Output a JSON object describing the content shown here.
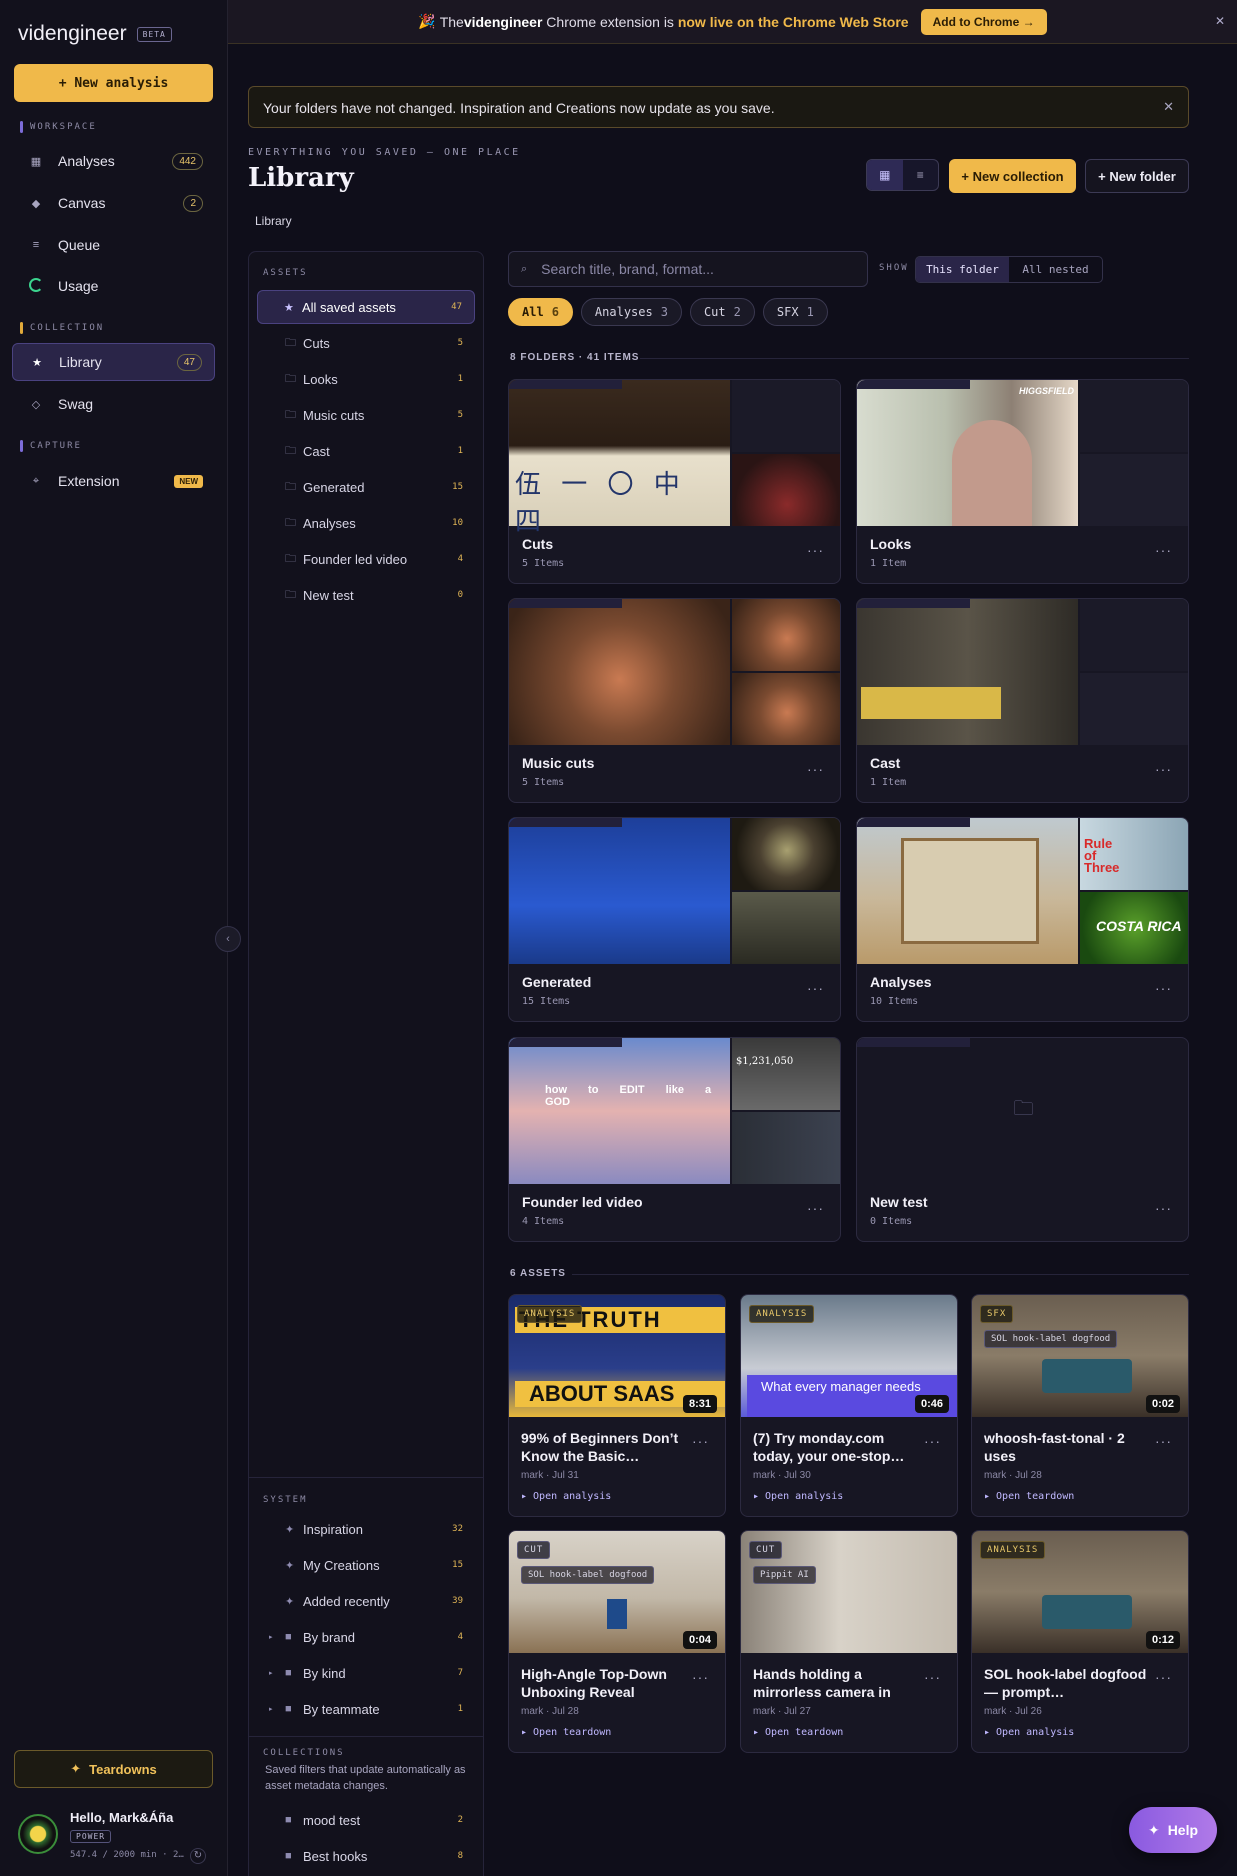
{
  "app": {
    "name": "videngineer",
    "badge": "BETA",
    "new_analysis": "+ New analysis"
  },
  "sidebar": {
    "workspace_label": "WORKSPACE",
    "collection_label": "COLLECTION",
    "capture_label": "CAPTURE",
    "items": [
      {
        "label": "Analyses",
        "badge": "442",
        "icon": "grid-icon"
      },
      {
        "label": "Canvas",
        "badge": "2",
        "icon": "diamond-icon"
      },
      {
        "label": "Queue",
        "icon": "list-icon"
      },
      {
        "label": "Usage",
        "icon": "ring-icon"
      },
      {
        "label": "Library",
        "badge": "47",
        "icon": "star-icon"
      },
      {
        "label": "Swag",
        "icon": "diamond-outline-icon"
      },
      {
        "label": "Extension",
        "badge": "NEW",
        "icon": "crosshair-icon"
      }
    ],
    "teardowns": "Teardowns",
    "profile": {
      "hello": "Hello, Mark&Áña",
      "tier": "POWER",
      "minutes": "547.4 / 2000 min · 2…"
    }
  },
  "banner": {
    "pre": "The ",
    "brand": "videngineer",
    "mid": " Chrome extension is ",
    "highlight": "now live on the Chrome Web Store",
    "button": "Add to Chrome →"
  },
  "notice": "Your folders have not changed. Inspiration and Creations now update as you save.",
  "header": {
    "eyebrow": "EVERYTHING YOU SAVED — ONE PLACE",
    "title": "Library",
    "breadcrumb": "Library",
    "new_collection": "+ New collection",
    "new_folder": "+ New folder"
  },
  "assets_panel": {
    "label": "ASSETS",
    "items": [
      {
        "label": "All saved assets",
        "count": "47"
      },
      {
        "label": "Cuts",
        "count": "5"
      },
      {
        "label": "Looks",
        "count": "1"
      },
      {
        "label": "Music cuts",
        "count": "5"
      },
      {
        "label": "Cast",
        "count": "1"
      },
      {
        "label": "Generated",
        "count": "15"
      },
      {
        "label": "Analyses",
        "count": "10"
      },
      {
        "label": "Founder led video",
        "count": "4"
      },
      {
        "label": "New test",
        "count": "0"
      }
    ],
    "system_label": "SYSTEM",
    "system": [
      {
        "label": "Inspiration",
        "count": "32"
      },
      {
        "label": "My Creations",
        "count": "15"
      },
      {
        "label": "Added recently",
        "count": "39"
      },
      {
        "label": "By brand",
        "count": "4"
      },
      {
        "label": "By kind",
        "count": "7"
      },
      {
        "label": "By teammate",
        "count": "1"
      }
    ],
    "collections_label": "COLLECTIONS",
    "collections_desc": "Saved filters that update automatically as asset metadata changes.",
    "collections": [
      {
        "label": "mood test",
        "count": "2"
      },
      {
        "label": "Best hooks",
        "count": "8"
      }
    ]
  },
  "toolbar": {
    "search_placeholder": "Search title, brand, format...",
    "show_label": "SHOW",
    "show_options": [
      "This folder",
      "All nested"
    ],
    "chips": [
      {
        "label": "All",
        "count": "6"
      },
      {
        "label": "Analyses",
        "count": "3"
      },
      {
        "label": "Cut",
        "count": "2"
      },
      {
        "label": "SFX",
        "count": "1"
      }
    ]
  },
  "folders_heading": "8 FOLDERS · 41 ITEMS",
  "folders": [
    {
      "name": "Cuts",
      "items": "5 Items"
    },
    {
      "name": "Looks",
      "items": "1 Item",
      "overlay": "HIGGSFIELD"
    },
    {
      "name": "Music cuts",
      "items": "5 Items"
    },
    {
      "name": "Cast",
      "items": "1 Item"
    },
    {
      "name": "Generated",
      "items": "15 Items"
    },
    {
      "name": "Analyses",
      "items": "10 Items"
    },
    {
      "name": "Founder led video",
      "items": "4 Items"
    },
    {
      "name": "New test",
      "items": "0 Items"
    }
  ],
  "assets_heading": "6 ASSETS",
  "assets": [
    {
      "tag": "ANALYSIS",
      "duration": "8:31",
      "title": "99% of Beginners Don’t Know the Basic…",
      "meta": "mark · Jul 31",
      "action": "▸ Open analysis"
    },
    {
      "tag": "ANALYSIS",
      "duration": "0:46",
      "title": "(7) Try monday.com today, your one-stop…",
      "meta": "mark · Jul 30",
      "action": "▸ Open analysis"
    },
    {
      "tag": "SFX",
      "sublabel": "SOL hook-label dogfood",
      "duration": "0:02",
      "title": "whoosh-fast-tonal · 2 uses",
      "meta": "mark · Jul 28",
      "action": "▸ Open teardown"
    },
    {
      "tag": "CUT",
      "sublabel": "SOL hook-label dogfood",
      "duration": "0:04",
      "title": "High-Angle Top-Down Unboxing Reveal",
      "meta": "mark · Jul 28",
      "action": "▸ Open teardown"
    },
    {
      "tag": "CUT",
      "sublabel": "Pippit AI",
      "title": "Hands holding a mirrorless camera in",
      "meta": "mark · Jul 27",
      "action": "▸ Open teardown"
    },
    {
      "tag": "ANALYSIS",
      "duration": "0:12",
      "title": "SOL hook-label dogfood — prompt…",
      "meta": "mark · Jul 26",
      "action": "▸ Open analysis"
    }
  ],
  "help": "Help"
}
